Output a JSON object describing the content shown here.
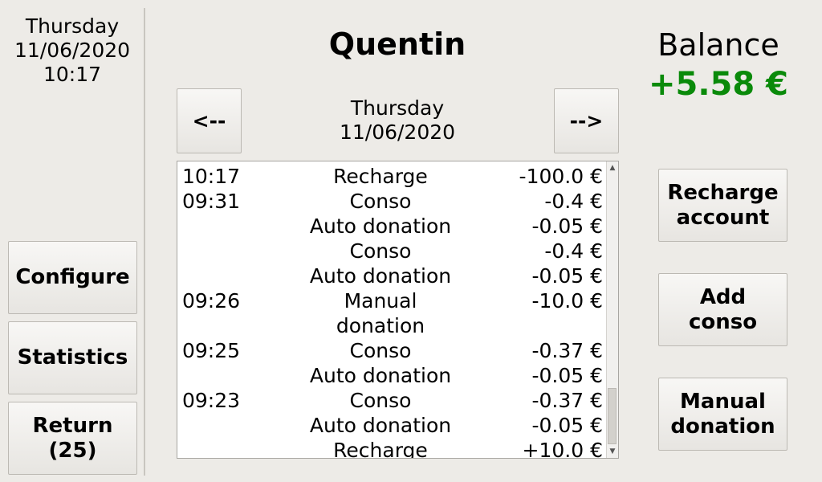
{
  "clock": {
    "day": "Thursday",
    "date": "11/06/2020",
    "time": "10:17"
  },
  "left_buttons": {
    "configure": "Configure",
    "statistics": "Statistics",
    "return_line1": "Return",
    "return_line2": "(25)"
  },
  "user": {
    "name": "Quentin"
  },
  "nav": {
    "prev": "<--",
    "next": "-->",
    "day": "Thursday",
    "date": "11/06/2020"
  },
  "balance": {
    "label": "Balance",
    "value": "+5.58 €",
    "color": "#0a8a0a"
  },
  "transactions": [
    {
      "time": "10:17",
      "label": "Recharge",
      "amount": "-100.0 €"
    },
    {
      "time": "09:31",
      "label": "Conso",
      "amount": "-0.4 €"
    },
    {
      "time": "",
      "label": "Auto donation",
      "amount": "-0.05 €"
    },
    {
      "time": "",
      "label": "Conso",
      "amount": "-0.4 €"
    },
    {
      "time": "",
      "label": "Auto donation",
      "amount": "-0.05 €"
    },
    {
      "time": "09:26",
      "label": "Manual",
      "amount": "-10.0 €"
    },
    {
      "time": "",
      "label": "donation",
      "amount": ""
    },
    {
      "time": "09:25",
      "label": "Conso",
      "amount": "-0.37 €"
    },
    {
      "time": "",
      "label": "Auto donation",
      "amount": "-0.05 €"
    },
    {
      "time": "09:23",
      "label": "Conso",
      "amount": "-0.37 €"
    },
    {
      "time": "",
      "label": "Auto donation",
      "amount": "-0.05 €"
    },
    {
      "time": "",
      "label": "Recharge",
      "amount": "+10.0 €"
    }
  ],
  "right_buttons": {
    "recharge_line1": "Recharge",
    "recharge_line2": "account",
    "add_line1": "Add",
    "add_line2": "conso",
    "manual_line1": "Manual",
    "manual_line2": "donation"
  },
  "icons": {
    "scroll_up": "arrow-up-icon",
    "scroll_down": "arrow-down-icon"
  }
}
